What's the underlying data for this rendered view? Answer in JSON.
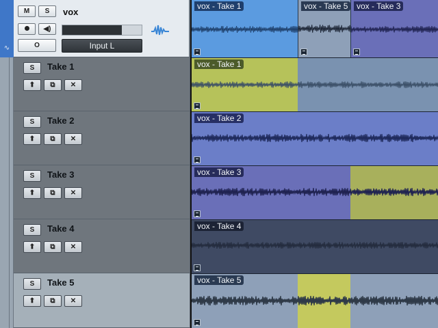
{
  "master": {
    "track_name": "vox",
    "mute_label": "M",
    "solo_label": "S",
    "monitor_label": "O",
    "input_label": "Input L",
    "meter_level": 0.75
  },
  "take_buttons": {
    "solo": "S",
    "up": "⬆",
    "copy": "⧉",
    "delete": "✕"
  },
  "takes": [
    {
      "name": "Take 1"
    },
    {
      "name": "Take 2"
    },
    {
      "name": "Take 3"
    },
    {
      "name": "Take 4"
    },
    {
      "name": "Take 5"
    }
  ],
  "master_regions": [
    {
      "label": "vox - Take 1"
    },
    {
      "label": "vox - Take 5"
    },
    {
      "label": "vox - Take 3"
    }
  ],
  "take_regions": [
    {
      "label": "vox - Take 1"
    },
    {
      "label": "vox - Take 2"
    },
    {
      "label": "vox - Take 3"
    },
    {
      "label": "vox - Take 4"
    },
    {
      "label": "vox - Take 5"
    }
  ],
  "colors": {
    "take1_blue": "#5b9be0",
    "take2_purple": "#6b7ec8",
    "take3_purple": "#6a6fb8",
    "take4_dark": "#3f4a63",
    "take5_gray": "#8ea0b8",
    "highlight_yellow": "#b6c25a",
    "icon_wave": "#3a86d6"
  },
  "icons": {
    "record": "record-icon",
    "speaker": "speaker-icon",
    "wave": "waveform-icon",
    "automation": "automation-icon"
  }
}
